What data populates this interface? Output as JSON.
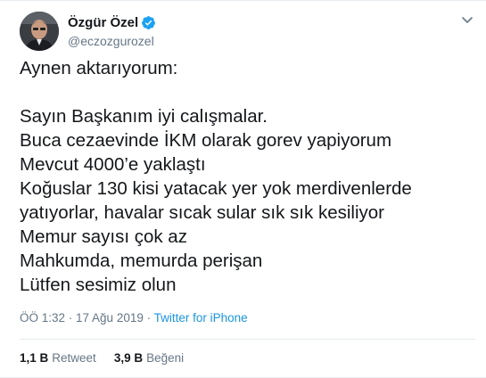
{
  "author": {
    "display_name": "Özgür Özel",
    "handle": "@eczozgurozel",
    "verified": true,
    "avatar_icon": "profile-photo"
  },
  "menu_icon": "chevron-down-icon",
  "tweet": {
    "lines": [
      "Aynen aktarıyorum:",
      "",
      "Sayın Başkanım iyi calışmalar.",
      "Buca cezaevinde İKM olarak gorev yapiyorum",
      "Mevcut 4000’e yaklaştı",
      "Koğuslar 130 kisi yatacak yer yok merdivenlerde",
      "yatıyorlar, havalar sıcak sular sık sık kesiliyor",
      "Memur sayısı çok az",
      "Mahkumda, memurda perişan",
      "Lütfen sesimiz olun"
    ]
  },
  "meta": {
    "timestamp": "ÖÖ 1:32 · 17 Ağu 2019",
    "separator": " · ",
    "source": "Twitter for iPhone"
  },
  "stats": {
    "retweets_count": "1,1 B",
    "retweets_label": "Retweet",
    "likes_count": "3,9 B",
    "likes_label": "Beğeni"
  },
  "colors": {
    "text": "#14171a",
    "secondary": "#657786",
    "link": "#1b95e0",
    "verified": "#1da1f2",
    "border": "#e6ecf0"
  }
}
